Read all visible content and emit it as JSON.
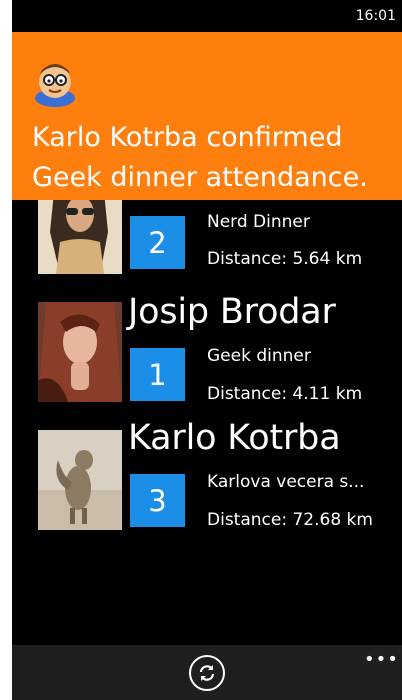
{
  "status_bar": {
    "time": "16:01"
  },
  "toast": {
    "icon": "nerd-avatar-icon",
    "line1": "Karlo Kotrba confirmed",
    "line2": "Geek dinner attendance."
  },
  "items": [
    {
      "name": "",
      "badge": "2",
      "event": "Nerd Dinner",
      "distance": "Distance: 5.64 km",
      "photo": "woman-sunglasses-photo"
    },
    {
      "name": "Josip Brodar",
      "badge": "1",
      "event": "Geek dinner",
      "distance": "Distance: 4.11 km",
      "photo": "woman-red-hair-photo"
    },
    {
      "name": "Karlo Kotrba",
      "badge": "3",
      "event": "Karlova vecera s...",
      "distance": "Distance: 72.68 km",
      "photo": "squirrel-photo"
    }
  ],
  "app_bar": {
    "refresh_icon": "refresh-icon",
    "more_icon": "ellipsis-icon",
    "more_label": "•••"
  },
  "colors": {
    "accent": "#ff7f0e",
    "badge": "#1b8fe8",
    "background": "#000000"
  }
}
